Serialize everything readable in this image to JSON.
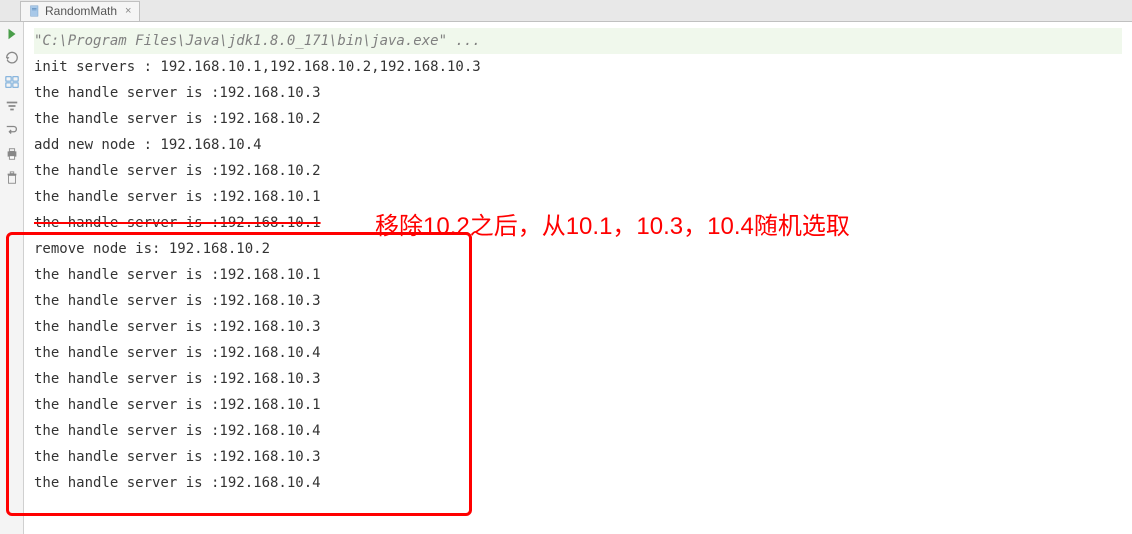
{
  "tab": {
    "label": "RandomMath",
    "close": "×"
  },
  "console": {
    "cmd": "\"C:\\Program Files\\Java\\jdk1.8.0_171\\bin\\java.exe\" ...",
    "lines": [
      "init servers : 192.168.10.1,192.168.10.2,192.168.10.3",
      "the handle server is :192.168.10.3",
      "the handle server is :192.168.10.2",
      "add new node : 192.168.10.4",
      "the handle server is :192.168.10.2",
      "the handle server is :192.168.10.1",
      "the handle server is :192.168.10.1",
      "remove node is: 192.168.10.2",
      "the handle server is :192.168.10.1",
      "the handle server is :192.168.10.3",
      "the handle server is :192.168.10.3",
      "the handle server is :192.168.10.4",
      "the handle server is :192.168.10.3",
      "the handle server is :192.168.10.1",
      "the handle server is :192.168.10.4",
      "the handle server is :192.168.10.3",
      "the handle server is :192.168.10.4"
    ]
  },
  "annotation": {
    "text": "移除10.2之后，从10.1，10.3，10.4随机选取"
  }
}
